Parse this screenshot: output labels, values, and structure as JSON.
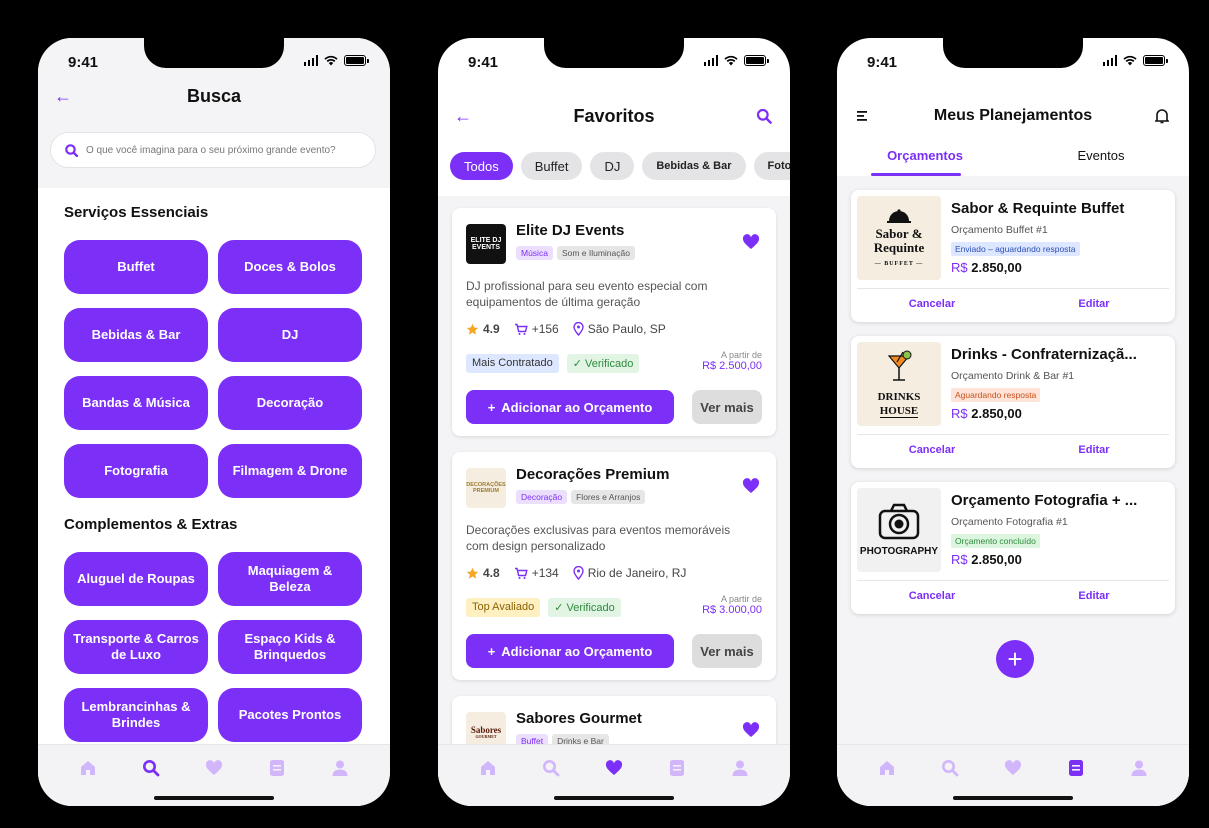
{
  "colors": {
    "accent": "#7b2ff7",
    "nav_inactive": "#d2b6fb"
  },
  "status": {
    "time": "9:41"
  },
  "screen1": {
    "title": "Busca",
    "search_placeholder": "O que você imagina para o seu próximo grande evento?",
    "section1_title": "Serviços Essenciais",
    "section1_items": [
      "Buffet",
      "Doces & Bolos",
      "Bebidas & Bar",
      "DJ",
      "Bandas & Música",
      "Decoração",
      "Fotografia",
      "Filmagem & Drone"
    ],
    "section2_title": "Complementos & Extras",
    "section2_items": [
      "Aluguel de Roupas",
      "Maquiagem & Beleza",
      "Transporte & Carros de Luxo",
      "Espaço Kids & Brinquedos",
      "Lembrancinhas & Brindes",
      "Pacotes Prontos"
    ]
  },
  "screen2": {
    "title": "Favoritos",
    "chips": [
      "Todos",
      "Buffet",
      "DJ",
      "Bebidas & Bar",
      "Fotografia"
    ],
    "cards": [
      {
        "logo": "ELITE DJ EVENTS",
        "name": "Elite DJ Events",
        "tag1": "Música",
        "tag2": "Som e Iluminação",
        "description": "DJ profissional para seu evento especial com equipamentos de última geração",
        "rating": "4.9",
        "count": "+156",
        "location": "São Paulo, SP",
        "badge1": "Mais Contratado",
        "badge2": "Verificado",
        "price_label": "A partir de",
        "price": "R$ 2.500,00",
        "add_label": "Adicionar ao Orçamento",
        "more_label": "Ver mais"
      },
      {
        "logo": "DECORAÇÕES PREMIUM",
        "name": "Decorações Premium",
        "tag1": "Decoração",
        "tag2": "Flores e Arranjos",
        "description": "Decorações exclusivas para eventos memoráveis com design personalizado",
        "rating": "4.8",
        "count": "+134",
        "location": "Rio de Janeiro, RJ",
        "badge1": "Top Avaliado",
        "badge2": "Verificado",
        "price_label": "A partir de",
        "price": "R$ 3.000,00",
        "add_label": "Adicionar ao Orçamento",
        "more_label": "Ver mais"
      },
      {
        "logo": "Sabores",
        "logo_sub": "GOURMET",
        "name": "Sabores Gourmet",
        "tag1": "Buffet",
        "tag2": "Drinks e Bar"
      }
    ]
  },
  "screen3": {
    "title": "Meus Planejamentos",
    "tab_active": "Orçamentos",
    "tab_other": "Eventos",
    "plans": [
      {
        "logo_line1": "Sabor &",
        "logo_line2": "Requinte",
        "logo_line3": "— BUFFET —",
        "title": "Sabor & Requinte Buffet",
        "subtitle": "Orçamento Buffet #1",
        "status": "Enviado – aguardando resposta",
        "status_bg": "#dde7ff",
        "status_color": "#2c4fb8",
        "currency": "R$",
        "amount": "2.850,00",
        "cancel": "Cancelar",
        "edit": "Editar"
      },
      {
        "logo_line1": "DRINKS",
        "logo_line2": "HOUSE",
        "title": "Drinks - Confraternizaçã...",
        "subtitle": "Orçamento Drink & Bar #1",
        "status": "Aguardando resposta",
        "status_bg": "#ffe3d6",
        "status_color": "#c8501c",
        "currency": "R$",
        "amount": "2.850,00",
        "cancel": "Cancelar",
        "edit": "Editar"
      },
      {
        "logo_line1": "PHOTOGRAPHY",
        "title": "Orçamento Fotografia + ...",
        "subtitle": "Orçamento Fotografia #1",
        "status": "Orçamento concluído",
        "status_bg": "#dcf5df",
        "status_color": "#2d8a3c",
        "currency": "R$",
        "amount": "2.850,00",
        "cancel": "Cancelar",
        "edit": "Editar"
      }
    ],
    "fab": "+"
  }
}
